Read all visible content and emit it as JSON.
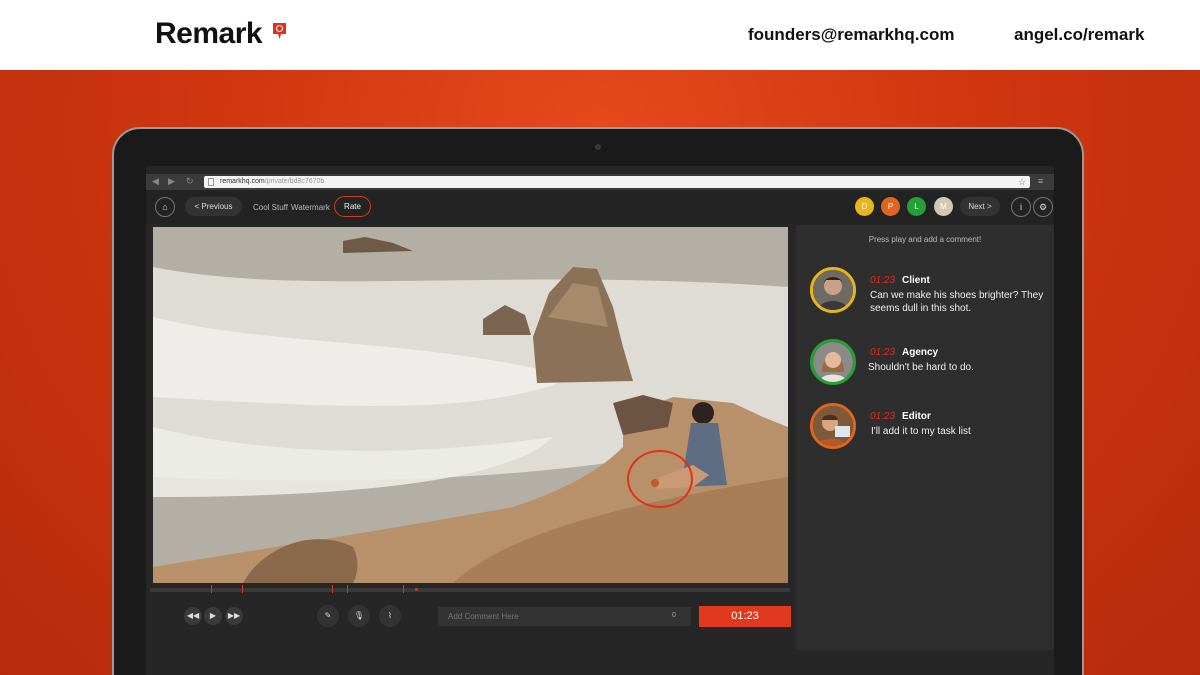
{
  "header": {
    "brand": "Remark",
    "email": "founders@remarkhq.com",
    "angel": "angel.co/remark"
  },
  "browser": {
    "url_host": "remarkhq.com",
    "url_path": "/private/bd8c7670b"
  },
  "toolbar": {
    "previous_label": "< Previous",
    "crumb_project": "Cool Stuff",
    "crumb_video": "Watermark",
    "rate_label": "Rate",
    "next_label": "Next >",
    "user_dots": [
      {
        "letter": "D",
        "color": "#e8b51b"
      },
      {
        "letter": "P",
        "color": "#e0651e"
      },
      {
        "letter": "L",
        "color": "#25a035"
      },
      {
        "letter": "M",
        "color": "#cfc9b4"
      }
    ]
  },
  "sidebar": {
    "hint": "Press play and add a comment!",
    "comments": [
      {
        "time": "01:23",
        "author": "Client",
        "text": "Can we make his shoes brighter? They seems dull in this shot.",
        "ring": "#e8b51b"
      },
      {
        "time": "01:23",
        "author": "Agency",
        "text": "Shouldn't be hard to do.",
        "ring": "#25a035"
      },
      {
        "time": "01:23",
        "author": "Editor",
        "text": "I'll add it to my task list",
        "ring": "#e0651e"
      }
    ]
  },
  "controls": {
    "comment_placeholder": "Add Comment Here",
    "char_count": "0",
    "timecode": "01:23"
  },
  "colors": {
    "accent": "#e0391d",
    "brand_bg": "#c4310f"
  }
}
